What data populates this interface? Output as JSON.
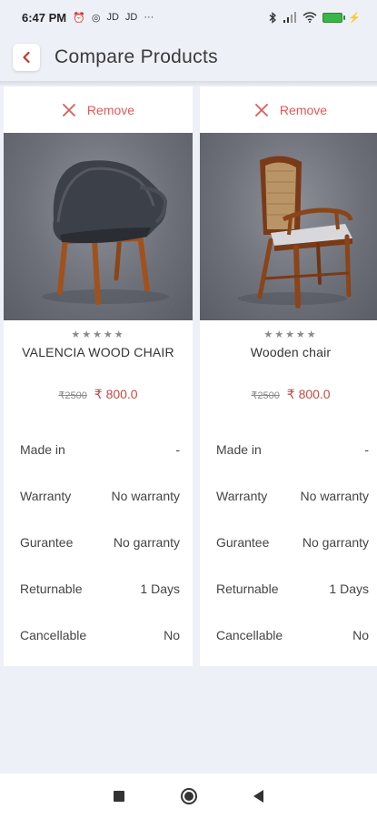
{
  "status_bar": {
    "time": "6:47 PM",
    "notification_icons": [
      "alarm-icon",
      "whatsapp-icon",
      "jd-icon",
      "jd-icon"
    ],
    "jd_label_1": "JD",
    "jd_label_2": "JD",
    "more": "···",
    "battery_color": "#39b54a"
  },
  "header": {
    "title": "Compare Products",
    "back_icon": "chevron-left-icon",
    "accent": "#c0392b"
  },
  "products": [
    {
      "remove_label": "Remove",
      "rating_stars": "★★★★★",
      "name": "VALENCIA WOOD CHAIR",
      "old_price": "₹2500",
      "new_price": "₹ 800.0",
      "specs": [
        {
          "label": "Made in",
          "value": "-"
        },
        {
          "label": "Warranty",
          "value": "No warranty"
        },
        {
          "label": "Gurantee",
          "value": "No garranty"
        },
        {
          "label": "Returnable",
          "value": "1 Days"
        },
        {
          "label": "Cancellable",
          "value": "No"
        }
      ]
    },
    {
      "remove_label": "Remove",
      "rating_stars": "★★★★★",
      "name": "Wooden chair",
      "old_price": "₹2500",
      "new_price": "₹ 800.0",
      "specs": [
        {
          "label": "Made in",
          "value": "-"
        },
        {
          "label": "Warranty",
          "value": "No warranty"
        },
        {
          "label": "Gurantee",
          "value": "No garranty"
        },
        {
          "label": "Returnable",
          "value": "1 Days"
        },
        {
          "label": "Cancellable",
          "value": "No"
        }
      ]
    }
  ],
  "colors": {
    "remove_red": "#e05a5a",
    "price_red": "#c24a44",
    "background": "#eef0f8"
  }
}
